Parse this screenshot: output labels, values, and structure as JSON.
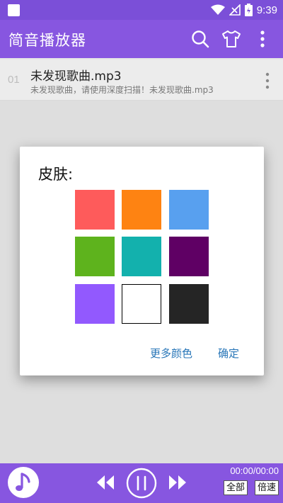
{
  "status_bar": {
    "time": "9:39"
  },
  "app_bar": {
    "title": "简音播放器",
    "actions": [
      "search-icon",
      "shirt-icon",
      "more-vert-icon"
    ]
  },
  "song": {
    "number": "01",
    "title": "未发现歌曲.mp3",
    "subtitle": "未发现歌曲，请使用深度扫描！未发现歌曲.mp3"
  },
  "dialog": {
    "title": "皮肤:",
    "swatches": [
      {
        "color": "#fe5b5b"
      },
      {
        "color": "#fe8312"
      },
      {
        "color": "#58a0ef"
      },
      {
        "color": "#5eb31d"
      },
      {
        "color": "#13b1ad"
      },
      {
        "color": "#5f0064"
      },
      {
        "color": "#9259fe"
      },
      {
        "color": "#ffffff"
      },
      {
        "color": "#252525"
      }
    ],
    "more_colors_label": "更多颜色",
    "confirm_label": "确定"
  },
  "player": {
    "time": "00:00/00:00",
    "mode_label": "全部",
    "speed_label": "倍速"
  },
  "colors": {
    "accent": "#8756e0",
    "status_bar": "#7b4fd8",
    "dialog_button": "#2876b8"
  }
}
